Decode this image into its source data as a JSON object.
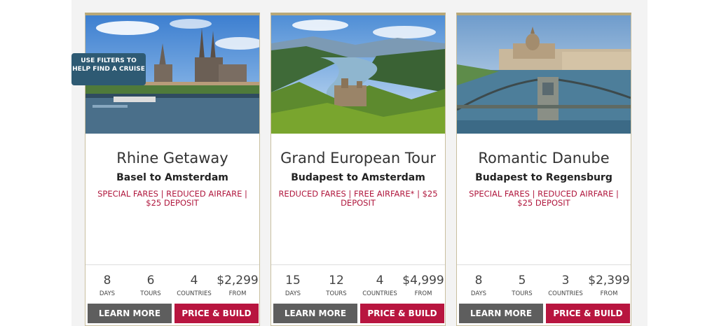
{
  "filter_tip": "USE FILTERS TO HELP FIND A CRUISE",
  "stat_labels": {
    "days": "DAYS",
    "tours": "TOURS",
    "countries": "COUNTRIES",
    "from": "FROM"
  },
  "buttons": {
    "learn_more": "LEARN MORE",
    "price_build": "PRICE & BUILD"
  },
  "cards": [
    {
      "title": "Rhine Getaway",
      "route": "Basel to Amsterdam",
      "offer": "SPECIAL FARES | REDUCED AIRFARE | $25 DEPOSIT",
      "days": "8",
      "tours": "6",
      "countries": "4",
      "price": "$2,299",
      "image": "cologne-cathedral-photo"
    },
    {
      "title": "Grand European Tour",
      "route": "Budapest to Amsterdam",
      "offer": "REDUCED FARES | FREE AIRFARE* | $25 DEPOSIT",
      "days": "15",
      "tours": "12",
      "countries": "4",
      "price": "$4,999",
      "image": "danube-valley-castle-photo"
    },
    {
      "title": "Romantic Danube",
      "route": "Budapest to Regensburg",
      "offer": "SPECIAL FARES | REDUCED AIRFARE | $25 DEPOSIT",
      "days": "8",
      "tours": "5",
      "countries": "3",
      "price": "$2,399",
      "image": "budapest-chain-bridge-photo"
    }
  ],
  "colors": {
    "accent": "#b8153f",
    "button_dark": "#5e5e5e",
    "tip_bg": "#2e5a73",
    "card_border": "#c9bf9f"
  }
}
